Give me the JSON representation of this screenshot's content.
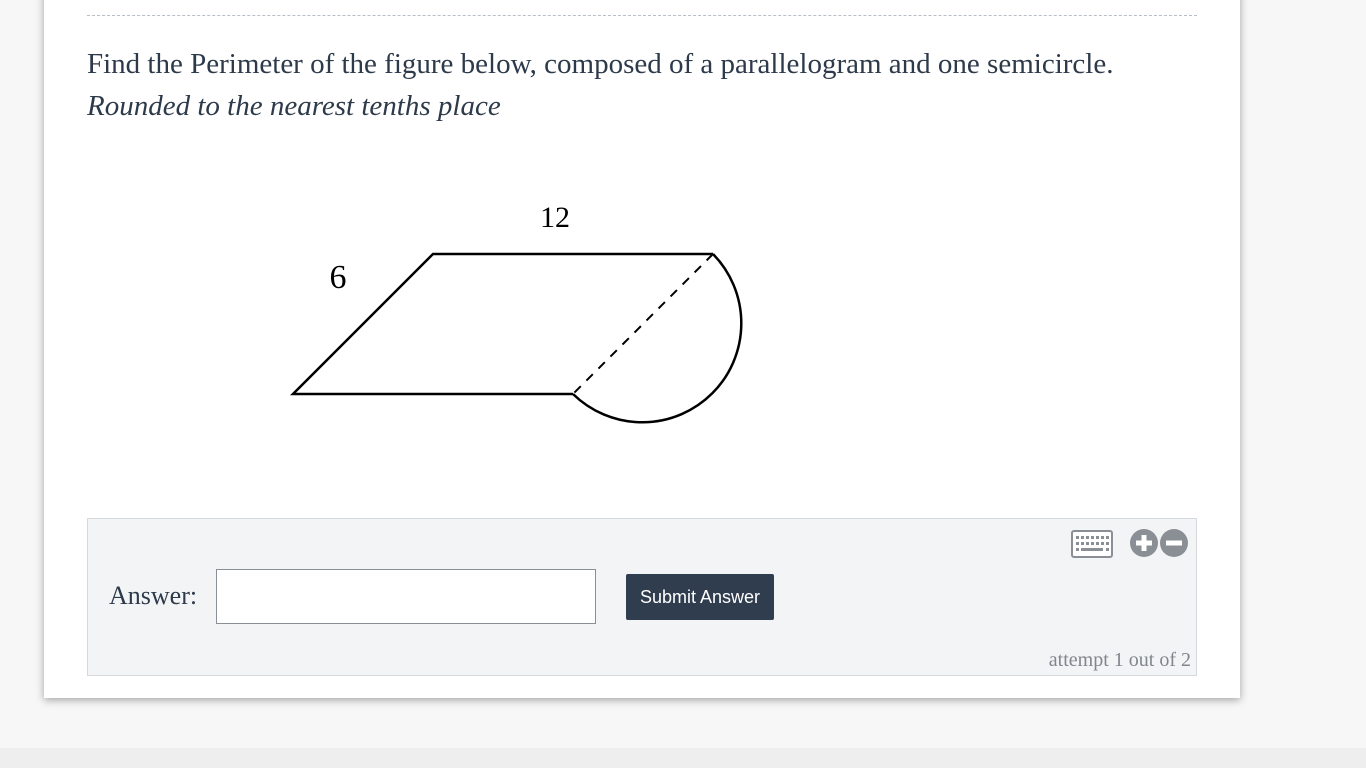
{
  "question": {
    "text": "Find the Perimeter of the figure below, composed of a parallelogram and one semicircle.",
    "instruction": "Rounded to the nearest tenths place"
  },
  "figure": {
    "label_top": "12",
    "label_side": "6"
  },
  "answer": {
    "label": "Answer:",
    "input_value": "",
    "submit_label": "Submit Answer",
    "attempt_text": "attempt 1 out of 2"
  },
  "icons": {
    "keyboard": "keyboard-icon",
    "zoom_in": "plus-circle-icon",
    "zoom_out": "minus-circle-icon"
  },
  "colors": {
    "text": "#2d3a4a",
    "button_bg": "#2f3d4f",
    "panel_bg": "#f3f4f6",
    "icon_gray": "#8a8f95"
  }
}
